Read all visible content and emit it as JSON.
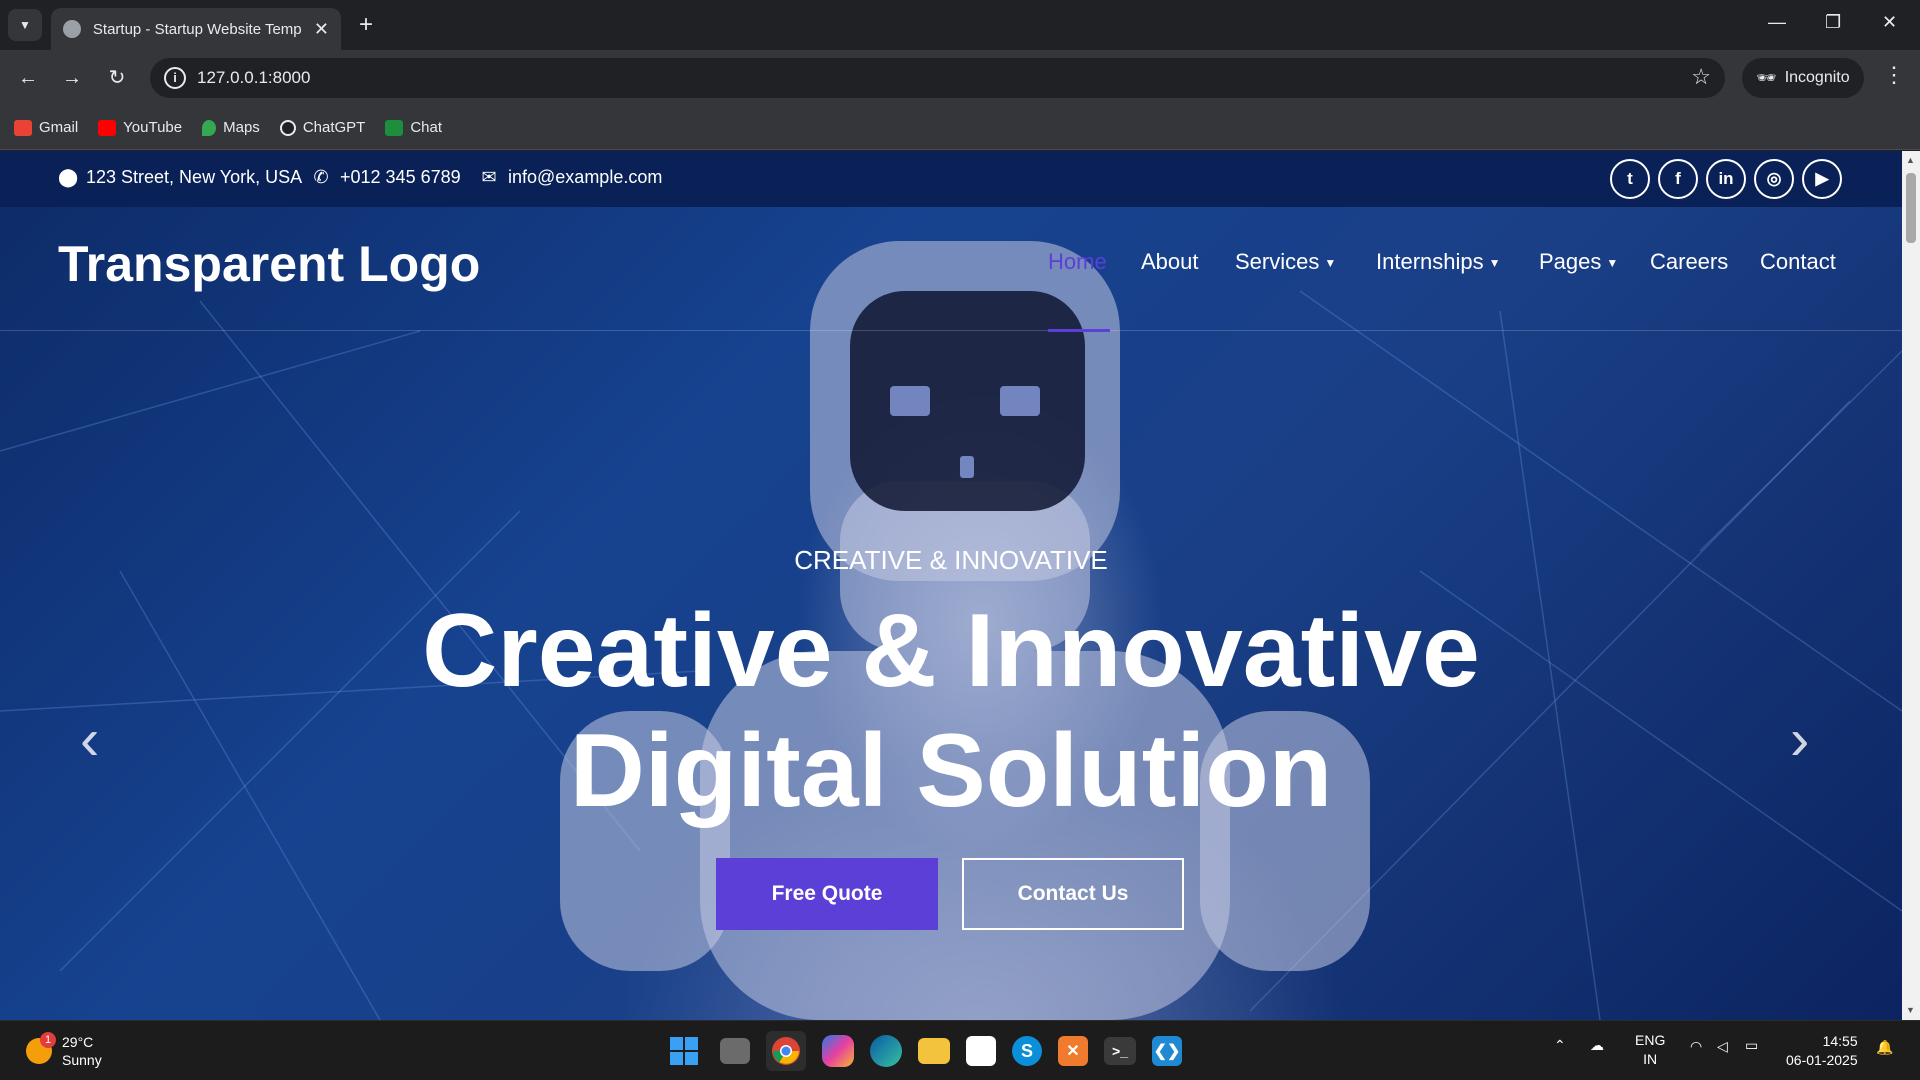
{
  "browser": {
    "tab_title": "Startup - Startup Website Temp",
    "url": "127.0.0.1:8000",
    "incognito_label": "Incognito",
    "bookmarks": [
      {
        "label": "Gmail",
        "color": "#ea4335"
      },
      {
        "label": "YouTube",
        "color": "#ff0000"
      },
      {
        "label": "Maps",
        "color": "#34a853"
      },
      {
        "label": "ChatGPT",
        "color": "#e8eaed"
      },
      {
        "label": "Chat",
        "color": "#1e8e3e"
      }
    ]
  },
  "topbar": {
    "address": "123 Street, New York, USA",
    "phone": "+012 345 6789",
    "email": "info@example.com",
    "social": [
      "twitter-icon",
      "facebook-icon",
      "linkedin-icon",
      "instagram-icon",
      "youtube-icon"
    ]
  },
  "navbar": {
    "logo": "Transparent Logo",
    "links": [
      "Home",
      "About",
      "Services",
      "Internships",
      "Pages",
      "Careers",
      "Contact"
    ],
    "active_link": "Home",
    "accent_color": "#5b3fd6"
  },
  "hero": {
    "subtitle": "CREATIVE & INNOVATIVE",
    "title_line1": "Creative & Innovative",
    "title_line2": "Digital Solution",
    "primary_button": "Free Quote",
    "secondary_button": "Contact Us"
  },
  "taskbar": {
    "temperature": "29°C",
    "condition": "Sunny",
    "notification_count": "1",
    "language": "ENG",
    "region": "IN",
    "time": "14:55",
    "date": "06-01-2025"
  }
}
